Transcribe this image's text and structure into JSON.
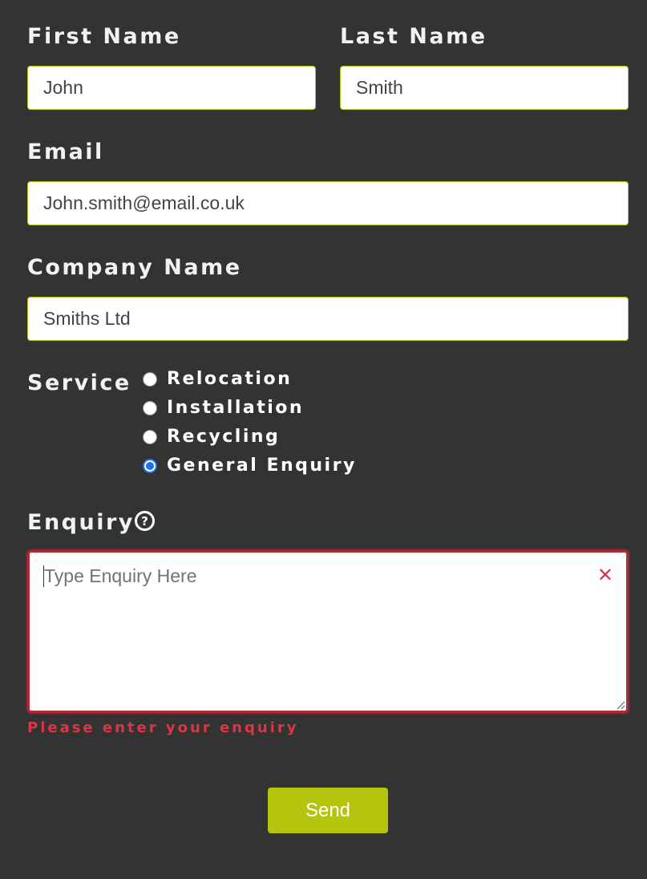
{
  "fields": {
    "first_name": {
      "label": "First Name",
      "value": "John"
    },
    "last_name": {
      "label": "Last Name",
      "value": "Smith"
    },
    "email": {
      "label": "Email",
      "value": "John.smith@email.co.uk"
    },
    "company": {
      "label": "Company Name",
      "value": "Smiths Ltd"
    }
  },
  "service": {
    "label": "Service",
    "options": [
      "Relocation",
      "Installation",
      "Recycling",
      "General Enquiry"
    ],
    "selected": "General Enquiry"
  },
  "enquiry": {
    "label": "Enquiry",
    "placeholder": "Type Enquiry Here",
    "value": "",
    "error": "Please enter your enquiry",
    "help_icon": "question-circle-icon",
    "clear_icon": "close-icon"
  },
  "send_label": "Send",
  "colors": {
    "background": "#333333",
    "accent": "#b5c40c",
    "error": "#dc3545",
    "radio_selected": "#1a73e8"
  }
}
